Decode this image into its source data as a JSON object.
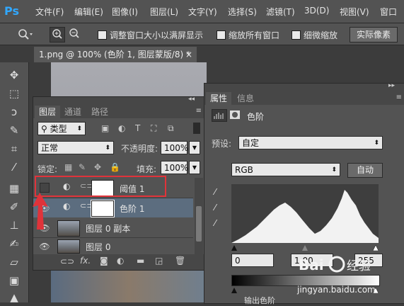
{
  "app": {
    "logo": "Ps"
  },
  "menu": [
    "文件(F)",
    "编辑(E)",
    "图像(I)",
    "图层(L)",
    "文字(Y)",
    "选择(S)",
    "滤镜(T)",
    "3D(D)",
    "视图(V)",
    "窗口"
  ],
  "options": {
    "resize_windows": "调整窗口大小以满屏显示",
    "zoom_all": "缩放所有窗口",
    "scrubby_zoom": "细微缩放",
    "actual_pixels": "实际像素"
  },
  "document": {
    "tab_title": "1.png @ 100% (色阶 1, 图层蒙版/8) *",
    "close": "×"
  },
  "layers_panel": {
    "tabs": [
      "图层",
      "通道",
      "路径"
    ],
    "filter_kind": "类型",
    "blend_mode": "正常",
    "opacity_label": "不透明度:",
    "opacity_value": "100%",
    "lock_label": "锁定:",
    "fill_label": "填充:",
    "fill_value": "100%",
    "layers": [
      {
        "name": "阈值 1",
        "visible": false,
        "selected": false
      },
      {
        "name": "色阶 1",
        "visible": true,
        "selected": true
      },
      {
        "name": "图层 0 副本",
        "visible": true,
        "selected": false
      },
      {
        "name": "图层 0",
        "visible": true,
        "selected": false
      }
    ]
  },
  "properties_panel": {
    "tabs": [
      "属性",
      "信息"
    ],
    "title": "色阶",
    "preset_label": "预设:",
    "preset_value": "自定",
    "channel": "RGB",
    "auto_button": "自动",
    "input_values": [
      "0",
      "1.00",
      "255"
    ],
    "output_label": "输出色阶"
  },
  "watermark": {
    "text": "jingyan.baidu.com",
    "logo": "Bai 经验"
  },
  "colors": {
    "panel": "#535353",
    "accent": "#31a8ff",
    "annotation": "#e0333a",
    "selected_layer": "#5c6d7f"
  }
}
